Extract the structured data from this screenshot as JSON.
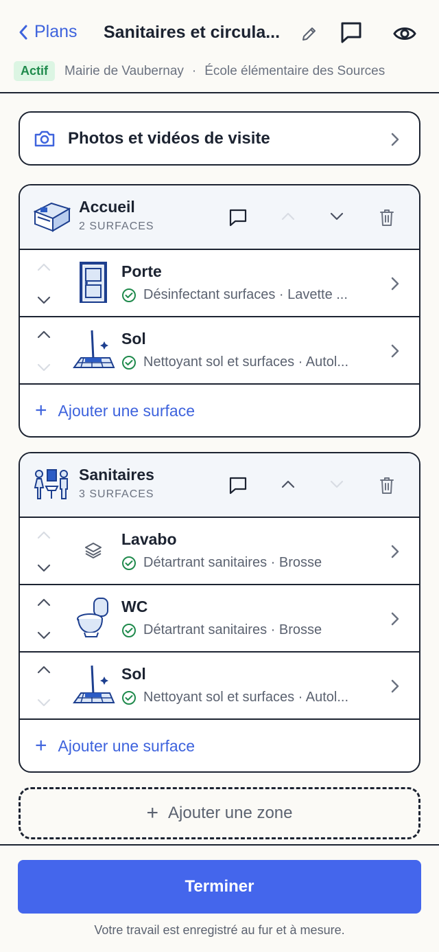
{
  "header": {
    "back_label": "Plans",
    "title": "Sanitaires et circula...",
    "status_badge": "Actif",
    "crumb_1": "Mairie de Vaubernay",
    "separator": "·",
    "crumb_2": "École élémentaire des Sources"
  },
  "photos": {
    "label": "Photos et vidéos de visite"
  },
  "zones": [
    {
      "name": "Accueil",
      "count": "2 SURFACES",
      "surfaces": [
        {
          "name": "Porte",
          "details": "Désinfectant surfaces · Lavette ..."
        },
        {
          "name": "Sol",
          "details": "Nettoyant sol et surfaces · Autol..."
        }
      ],
      "add_surface": "Ajouter une surface"
    },
    {
      "name": "Sanitaires",
      "count": "3 SURFACES",
      "surfaces": [
        {
          "name": "Lavabo",
          "details": "Détartrant sanitaires · Brosse"
        },
        {
          "name": "WC",
          "details": "Détartrant sanitaires · Brosse"
        },
        {
          "name": "Sol",
          "details": "Nettoyant sol et surfaces · Autol..."
        }
      ],
      "add_surface": "Ajouter une surface"
    }
  ],
  "add_zone": "Ajouter une zone",
  "footer": {
    "finish_label": "Terminer",
    "note": "Votre travail est enregistré au fur et à mesure."
  },
  "colors": {
    "accent": "#4466ec",
    "link": "#3e63dd",
    "success": "#1f8a4c",
    "border": "#1c2331"
  }
}
